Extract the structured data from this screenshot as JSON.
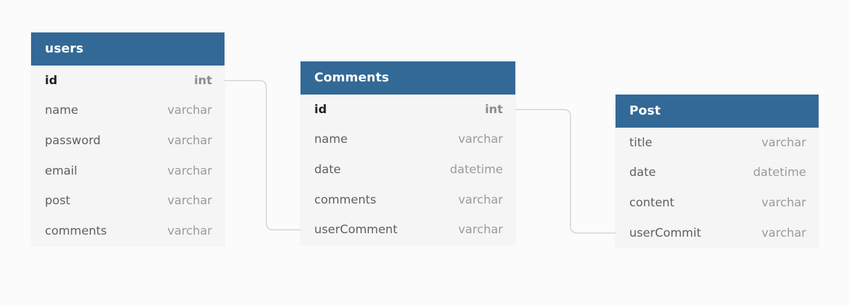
{
  "colors": {
    "header": "#336996",
    "connector": "#d4d4d4",
    "background": "#fbfbfb"
  },
  "tables": {
    "users": {
      "title": "users",
      "fields": [
        {
          "name": "id",
          "type": "int",
          "pk": true
        },
        {
          "name": "name",
          "type": "varchar"
        },
        {
          "name": "password",
          "type": "varchar"
        },
        {
          "name": "email",
          "type": "varchar"
        },
        {
          "name": "post",
          "type": "varchar"
        },
        {
          "name": "comments",
          "type": "varchar"
        }
      ]
    },
    "comments": {
      "title": "Comments",
      "fields": [
        {
          "name": "id",
          "type": "int",
          "pk": true
        },
        {
          "name": "name",
          "type": "varchar"
        },
        {
          "name": "date",
          "type": "datetime"
        },
        {
          "name": "comments",
          "type": "varchar"
        },
        {
          "name": "userComment",
          "type": "varchar"
        }
      ]
    },
    "post": {
      "title": "Post",
      "fields": [
        {
          "name": "title",
          "type": "varchar"
        },
        {
          "name": "date",
          "type": "datetime"
        },
        {
          "name": "content",
          "type": "varchar"
        },
        {
          "name": "userCommit",
          "type": "varchar"
        }
      ]
    }
  },
  "relations": [
    {
      "from": "users.id",
      "to": "comments.userComment"
    },
    {
      "from": "comments.id",
      "to": "post.userCommit"
    }
  ]
}
